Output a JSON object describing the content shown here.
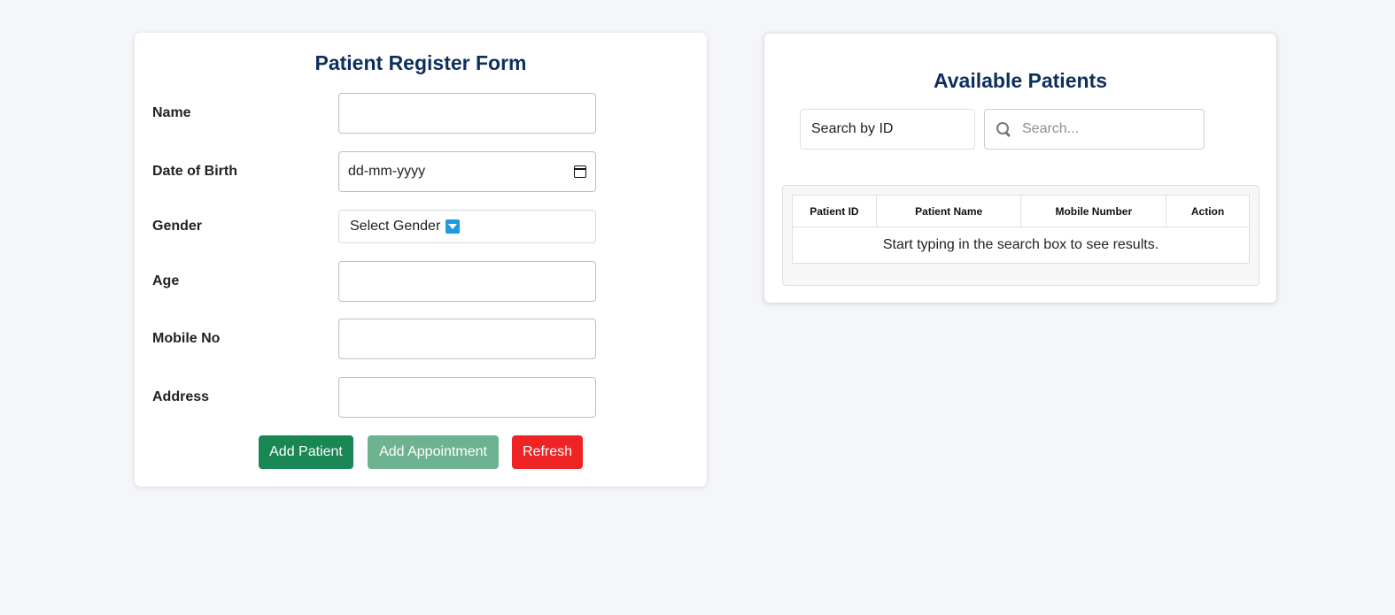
{
  "form": {
    "title": "Patient Register Form",
    "fields": {
      "name": {
        "label": "Name",
        "value": ""
      },
      "dob": {
        "label": "Date of Birth",
        "placeholder": "dd-mm-yyyy"
      },
      "gender": {
        "label": "Gender",
        "selected": "Select Gender"
      },
      "age": {
        "label": "Age",
        "value": ""
      },
      "mobile": {
        "label": "Mobile No",
        "value": ""
      },
      "address": {
        "label": "Address",
        "value": ""
      }
    },
    "buttons": {
      "add_patient": "Add Patient",
      "add_appointment": "Add Appointment",
      "refresh": "Refresh"
    }
  },
  "patients": {
    "title": "Available Patients",
    "search_by": "Search by ID",
    "search_placeholder": "Search...",
    "table": {
      "columns": [
        "Patient ID",
        "Patient Name",
        "Mobile Number",
        "Action"
      ],
      "empty_message": "Start typing in the search box to see results."
    }
  },
  "colors": {
    "title": "#0e2f5e",
    "add_patient": "#198754",
    "add_appointment": "#6db291",
    "refresh": "#ee2424",
    "dropdown_icon": "#1d9be0"
  },
  "icons": {
    "dob": "calendar-icon",
    "gender": "dropdown-arrow-icon",
    "search": "search-icon"
  }
}
